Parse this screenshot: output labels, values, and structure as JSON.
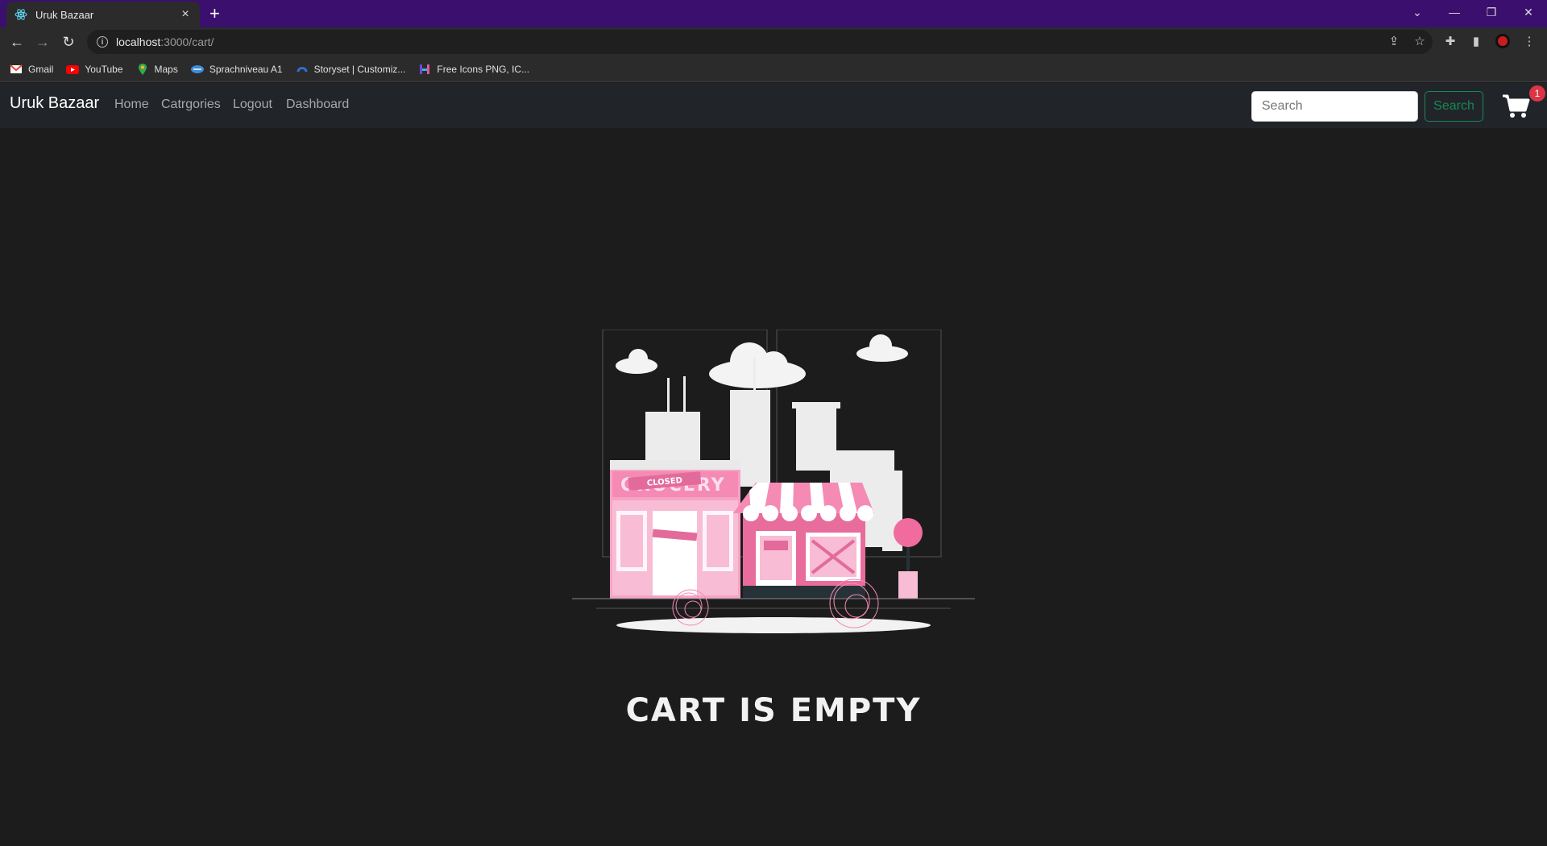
{
  "browser": {
    "tab_title": "Uruk Bazaar",
    "tab_close": "×",
    "new_tab": "+",
    "url_host": "localhost",
    "url_path": ":3000/cart/",
    "bookmarks": [
      {
        "label": "Gmail",
        "icon": "gmail-icon",
        "color": "#ea4335"
      },
      {
        "label": "YouTube",
        "icon": "youtube-icon",
        "color": "#ff0000"
      },
      {
        "label": "Maps",
        "icon": "maps-icon",
        "color": "#34a853"
      },
      {
        "label": "Sprachniveau A1",
        "icon": "sprachniveau-icon",
        "color": "#3d8bd9"
      },
      {
        "label": "Storyset | Customiz...",
        "icon": "storyset-icon",
        "color": "#2f6fd6"
      },
      {
        "label": "Free Icons PNG, IC...",
        "icon": "freeicons-icon",
        "color": "#6d4bd8"
      }
    ]
  },
  "navbar": {
    "brand": "Uruk Bazaar",
    "links": [
      "Home",
      "Catrgories",
      "Logout",
      "Dashboard"
    ],
    "search_placeholder": "Search",
    "search_button": "Search",
    "cart_count": "1"
  },
  "main": {
    "illustration_sign": "CLOSED",
    "illustration_shop_name": "GROCERY",
    "heading": "CART IS EMPTY"
  },
  "colors": {
    "titlebar": "#3a0f6e",
    "accent_pink": "#f58ab5",
    "search_green": "#198754",
    "badge_red": "#dc3545"
  }
}
